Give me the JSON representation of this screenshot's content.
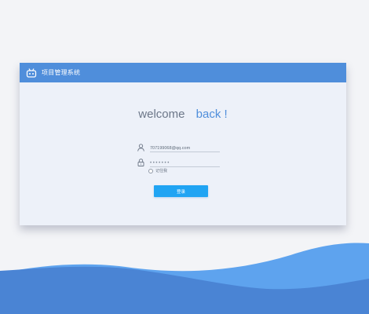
{
  "app": {
    "title": "项目管理系统",
    "logo_icon": "robot-logo-icon"
  },
  "welcome": {
    "word1": "welcome",
    "word2": "back !"
  },
  "login_form": {
    "username_value": "707199068@qq.com",
    "password_value": "•••••••",
    "remember_label": "记住我",
    "remember_checked": false,
    "submit_label": "登录"
  },
  "colors": {
    "header_blue": "#4f8edb",
    "button_blue": "#20a4f3",
    "card_background": "#edf1f9",
    "wave_dark": "#4a84d4",
    "wave_light": "#5ea3ee"
  }
}
